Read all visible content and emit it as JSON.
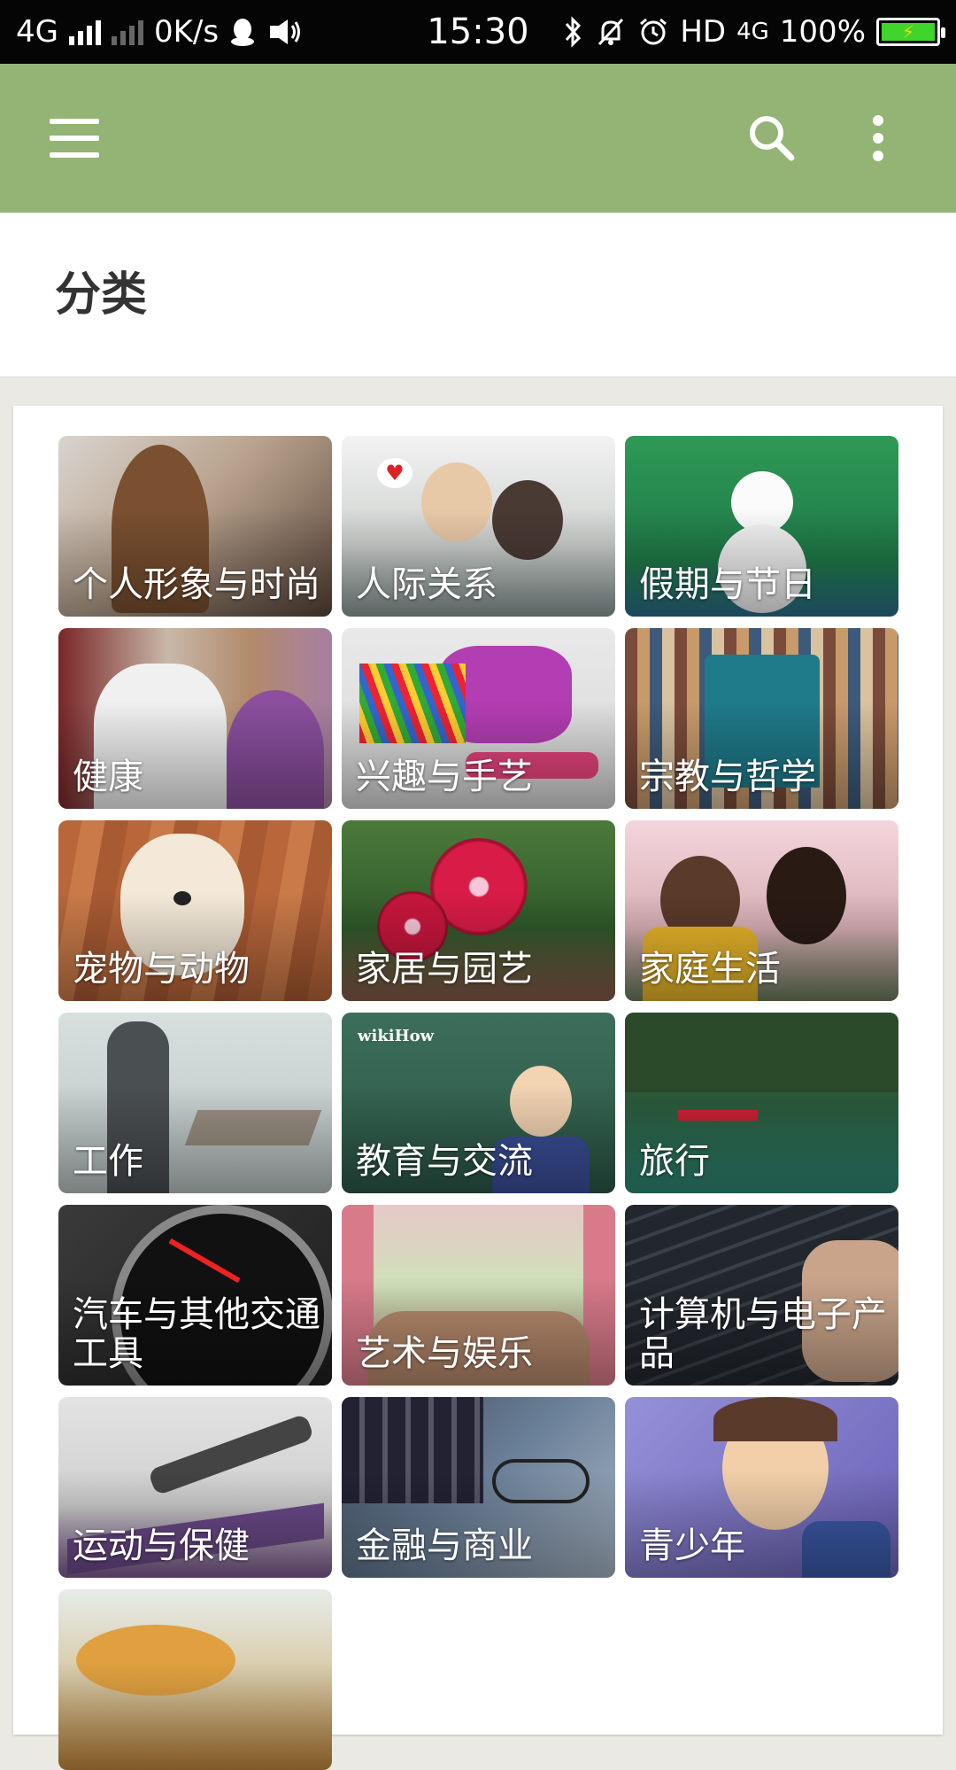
{
  "status_bar": {
    "network": "4G",
    "speed": "0K/s",
    "time": "15:30",
    "hd": "HD",
    "network2": "4G",
    "battery": "100%",
    "accent_battery": "#3fd52c"
  },
  "toolbar": {
    "color": "#93b474",
    "menu_icon": "hamburger-icon",
    "search_icon": "search-icon",
    "more_icon": "more-vert-icon"
  },
  "page": {
    "title": "分类"
  },
  "categories": [
    {
      "label": "个人形象与时尚"
    },
    {
      "label": "人际关系"
    },
    {
      "label": "假期与节日"
    },
    {
      "label": "健康"
    },
    {
      "label": "兴趣与手艺"
    },
    {
      "label": "宗教与哲学"
    },
    {
      "label": "宠物与动物"
    },
    {
      "label": "家居与园艺"
    },
    {
      "label": "家庭生活"
    },
    {
      "label": "工作"
    },
    {
      "label": "教育与交流"
    },
    {
      "label": "旅行"
    },
    {
      "label": "汽车与其他交通工具"
    },
    {
      "label": "艺术与娱乐"
    },
    {
      "label": "计算机与电子产品"
    },
    {
      "label": "运动与保健"
    },
    {
      "label": "金融与商业"
    },
    {
      "label": "青少年"
    },
    {
      "label": ""
    }
  ]
}
